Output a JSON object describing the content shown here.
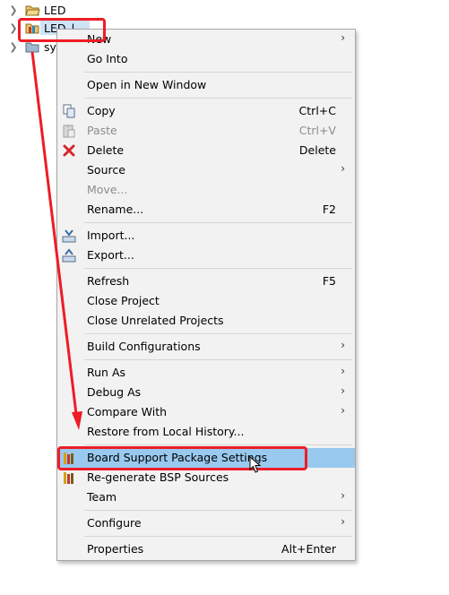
{
  "tree": [
    {
      "label": "LED"
    },
    {
      "label": "LED_l"
    },
    {
      "label": "sy"
    }
  ],
  "menu": {
    "new": "New",
    "go_into": "Go Into",
    "open_new_window": "Open in New Window",
    "copy": "Copy",
    "copy_sc": "Ctrl+C",
    "paste": "Paste",
    "paste_sc": "Ctrl+V",
    "delete": "Delete",
    "delete_sc": "Delete",
    "source": "Source",
    "move": "Move...",
    "rename": "Rename...",
    "rename_sc": "F2",
    "import": "Import...",
    "export": "Export...",
    "refresh": "Refresh",
    "refresh_sc": "F5",
    "close_project": "Close Project",
    "close_unrelated": "Close Unrelated Projects",
    "build_configs": "Build Configurations",
    "run_as": "Run As",
    "debug_as": "Debug As",
    "compare_with": "Compare With",
    "restore_history": "Restore from Local History...",
    "bsp_settings": "Board Support Package Settings",
    "regen_bsp": "Re-generate BSP Sources",
    "team": "Team",
    "configure": "Configure",
    "properties": "Properties",
    "properties_sc": "Alt+Enter"
  },
  "colors": {
    "annotation": "#ee1c25",
    "highlight": "#99c9ef",
    "menu_bg": "#f2f2f2"
  }
}
